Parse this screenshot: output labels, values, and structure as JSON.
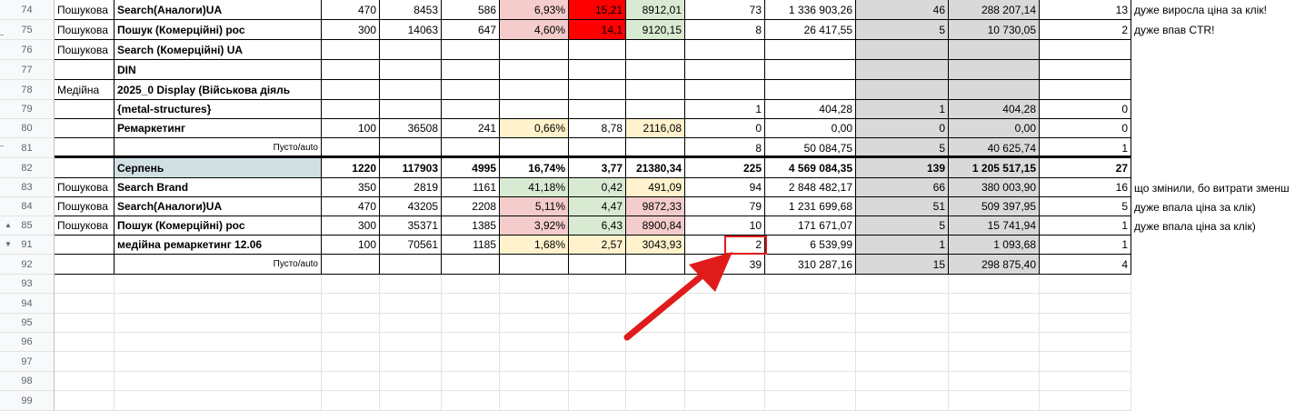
{
  "rows": [
    {
      "num": "74",
      "cells": {
        "a": "Пошукова",
        "b": "Search(Аналоги)UA",
        "c": "470",
        "d": "8453",
        "e": "586",
        "f": "6,93%",
        "g": "15,21",
        "h": "8912,01",
        "i": "73",
        "j": "1 336 903,26",
        "k": "46",
        "l": "288 207,14",
        "m": "13",
        "n": "дуже виросла ціна за клік!"
      }
    },
    {
      "num": "75",
      "cells": {
        "a": "Пошукова",
        "b": "Пошук (Комерційні) рос",
        "c": "300",
        "d": "14063",
        "e": "647",
        "f": "4,60%",
        "g": "14,1",
        "h": "9120,15",
        "i": "8",
        "j": "26 417,55",
        "k": "5",
        "l": "10 730,05",
        "m": "2",
        "n": "дуже впав CTR!"
      }
    },
    {
      "num": "76",
      "cells": {
        "a": "Пошукова",
        "b": "Search (Комерційні) UA"
      }
    },
    {
      "num": "77",
      "cells": {
        "b": "DIN"
      }
    },
    {
      "num": "78",
      "cells": {
        "a": "Медійна",
        "b": "2025_0 Display (Військова діяль"
      }
    },
    {
      "num": "79",
      "cells": {
        "b": "{metal-structures}",
        "i": "1",
        "j": "404,28",
        "k": "1",
        "l": "404,28",
        "m": "0"
      }
    },
    {
      "num": "80",
      "cells": {
        "b": "Ремаркетинг",
        "c": "100",
        "d": "36508",
        "e": "241",
        "f": "0,66%",
        "g": "8,78",
        "h": "2116,08",
        "i": "0",
        "j": "0,00",
        "k": "0",
        "l": "0,00",
        "m": "0"
      }
    },
    {
      "num": "81",
      "cells": {
        "b": "Пусто/auto",
        "i": "8",
        "j": "50 084,75",
        "k": "5",
        "l": "40 625,74",
        "m": "1"
      }
    },
    {
      "num": "82",
      "cells": {
        "b": "Серпень",
        "c": "1220",
        "d": "117903",
        "e": "4995",
        "f": "16,74%",
        "g": "3,77",
        "h": "21380,34",
        "i": "225",
        "j": "4 569 084,35",
        "k": "139",
        "l": "1 205 517,15",
        "m": "27"
      }
    },
    {
      "num": "83",
      "cells": {
        "a": "Пошукова",
        "b": "Search Brand",
        "c": "350",
        "d": "2819",
        "e": "1161",
        "f": "41,18%",
        "g": "0,42",
        "h": "491,09",
        "i": "94",
        "j": "2 848 482,17",
        "k": "66",
        "l": "380 003,90",
        "m": "16",
        "n": "що змінили, бо витрати зменш"
      }
    },
    {
      "num": "84",
      "cells": {
        "a": "Пошукова",
        "b": "Search(Аналоги)UA",
        "c": "470",
        "d": "43205",
        "e": "2208",
        "f": "5,11%",
        "g": "4,47",
        "h": "9872,33",
        "i": "79",
        "j": "1 231 699,68",
        "k": "51",
        "l": "509 397,95",
        "m": "5",
        "n": "дуже впала ціна за клік)"
      }
    },
    {
      "num": "85",
      "cells": {
        "a": "Пошукова",
        "b": "Пошук (Комерційні) рос",
        "c": "300",
        "d": "35371",
        "e": "1385",
        "f": "3,92%",
        "g": "6,43",
        "h": "8900,84",
        "i": "10",
        "j": "171 671,07",
        "k": "5",
        "l": "15 741,94",
        "m": "1",
        "n": "дуже впала ціна за клік)"
      }
    },
    {
      "num": "91",
      "cells": {
        "b": "медійна ремаркетинг 12.06",
        "c": "100",
        "d": "70561",
        "e": "1185",
        "f": "1,68%",
        "g": "2,57",
        "h": "3043,93",
        "i": "2",
        "j": "6 539,99",
        "k": "1",
        "l": "1 093,68",
        "m": "1"
      }
    },
    {
      "num": "92",
      "cells": {
        "b": "Пусто/auto",
        "i": "39",
        "j": "310 287,16",
        "k": "15",
        "l": "298 875,40",
        "m": "4"
      }
    },
    {
      "num": "93",
      "cells": {}
    },
    {
      "num": "94",
      "cells": {}
    },
    {
      "num": "95",
      "cells": {}
    },
    {
      "num": "96",
      "cells": {}
    },
    {
      "num": "97",
      "cells": {}
    },
    {
      "num": "98",
      "cells": {}
    },
    {
      "num": "99",
      "cells": {}
    }
  ],
  "colors": {
    "pink": "#f4cccc",
    "red": "#ff0000",
    "green": "#d9ead3",
    "yellow": "#fff2cc",
    "blue": "#d0e0e3",
    "gray": "#d9d9d9",
    "highlight": "#e01b1b"
  },
  "icons": {
    "expand": "triangle-up-icon",
    "collapse": "triangle-down-icon",
    "annotation": "red-arrow-icon"
  }
}
